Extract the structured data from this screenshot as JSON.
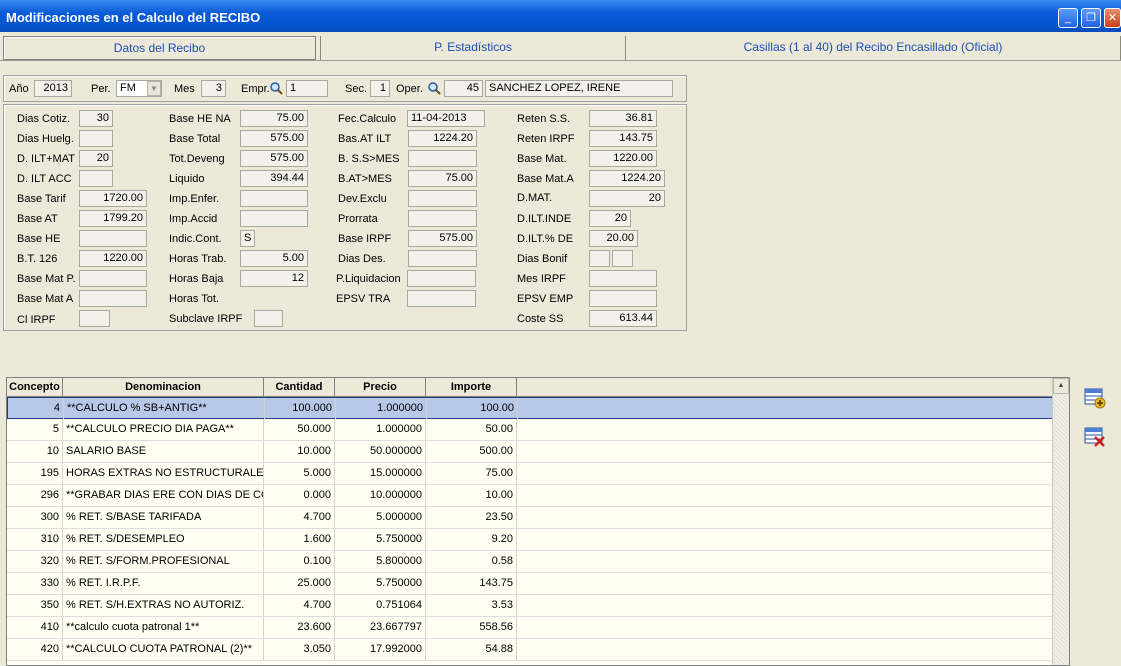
{
  "window": {
    "title": "Modificaciones en el Calculo del RECIBO"
  },
  "tabs": [
    {
      "label": "Datos del Recibo"
    },
    {
      "label": "P. Estadísticos"
    },
    {
      "label": "Casillas (1 al 40) del Recibo Encasillado (Oficial)"
    }
  ],
  "header": {
    "anio_label": "Año",
    "anio": "2013",
    "per_label": "Per.",
    "per": "FM",
    "mes_label": "Mes",
    "mes": "3",
    "empr_label": "Empr.",
    "empr": "1",
    "sec_label": "Sec.",
    "sec": "1",
    "oper_label": "Oper.",
    "oper": "45",
    "oper_name": "SANCHEZ LOPEZ, IRENE"
  },
  "col1": [
    {
      "label": "Dias Cotiz.",
      "value": "30"
    },
    {
      "label": "Dias Huelg.",
      "value": ""
    },
    {
      "label": "D. ILT+MAT",
      "value": "20"
    },
    {
      "label": "D. ILT ACC",
      "value": ""
    },
    {
      "label": "Base Tarif",
      "value": "1720.00"
    },
    {
      "label": "Base AT",
      "value": "1799.20"
    },
    {
      "label": "Base HE",
      "value": ""
    },
    {
      "label": "B.T. 126",
      "value": "1220.00"
    },
    {
      "label": "Base Mat P.",
      "value": ""
    },
    {
      "label": "Base Mat  A",
      "value": ""
    },
    {
      "label": "Cl IRPF",
      "value": ""
    }
  ],
  "col2": [
    {
      "label": "Base HE NA",
      "value": "75.00"
    },
    {
      "label": "Base Total",
      "value": "575.00"
    },
    {
      "label": "Tot.Deveng",
      "value": "575.00"
    },
    {
      "label": "Liquido",
      "value": "394.44"
    },
    {
      "label": "Imp.Enfer.",
      "value": ""
    },
    {
      "label": "Imp.Accid",
      "value": ""
    },
    {
      "label": "Indic.Cont.",
      "value": "S"
    },
    {
      "label": "Horas Trab.",
      "value": "5.00"
    },
    {
      "label": "Horas Baja",
      "value": "12"
    },
    {
      "label": "Horas Tot.",
      "value": ""
    },
    {
      "label": "Subclave IRPF",
      "value": ""
    }
  ],
  "col3": [
    {
      "label": "Fec.Calculo",
      "value": "11-04-2013"
    },
    {
      "label": "Bas.AT ILT",
      "value": "1224.20"
    },
    {
      "label": "B. S.S>MES",
      "value": ""
    },
    {
      "label": "B.AT>MES",
      "value": "75.00"
    },
    {
      "label": "Dev.Exclu",
      "value": ""
    },
    {
      "label": "Prorrata",
      "value": ""
    },
    {
      "label": "Base IRPF",
      "value": "575.00"
    },
    {
      "label": "Dias Des.",
      "value": ""
    },
    {
      "label": "P.Liquidacion",
      "value": ""
    },
    {
      "label": "EPSV TRA",
      "value": ""
    }
  ],
  "col4": [
    {
      "label": "Reten S.S.",
      "value": "36.81"
    },
    {
      "label": "Reten IRPF",
      "value": "143.75"
    },
    {
      "label": "Base Mat.",
      "value": "1220.00"
    },
    {
      "label": "Base Mat.A",
      "value": "1224.20"
    },
    {
      "label": "D.MAT.",
      "value": "20"
    },
    {
      "label": "D.ILT.INDE",
      "value": "20"
    },
    {
      "label": "D.ILT.% DE",
      "value": "20.00"
    },
    {
      "label": "Dias Bonif",
      "value": ""
    },
    {
      "label": "Mes IRPF",
      "value": ""
    },
    {
      "label": "EPSV EMP",
      "value": ""
    },
    {
      "label": "Coste SS",
      "value": "613.44"
    }
  ],
  "grid": {
    "columns": [
      "Concepto",
      "Denominacion",
      "Cantidad",
      "Precio",
      "Importe"
    ],
    "rows": [
      [
        "4",
        "**CALCULO % SB+ANTIG**",
        "100.000",
        "1.000000",
        "100.00"
      ],
      [
        "5",
        "**CALCULO PRECIO DIA PAGA**",
        "50.000",
        "1.000000",
        "50.00"
      ],
      [
        "10",
        "SALARIO BASE",
        "10.000",
        "50.000000",
        "500.00"
      ],
      [
        "195",
        "HORAS EXTRAS NO ESTRUCTURALES",
        "5.000",
        "15.000000",
        "75.00"
      ],
      [
        "296",
        "**GRABAR DIAS ERE CON DIAS DE COT*",
        "0.000",
        "10.000000",
        "10.00"
      ],
      [
        "300",
        "% RET. S/BASE TARIFADA",
        "4.700",
        "5.000000",
        "23.50"
      ],
      [
        "310",
        "% RET. S/DESEMPLEO",
        "1.600",
        "5.750000",
        "9.20"
      ],
      [
        "320",
        "% RET. S/FORM.PROFESIONAL",
        "0.100",
        "5.800000",
        "0.58"
      ],
      [
        "330",
        "% RET. I.R.P.F.",
        "25.000",
        "5.750000",
        "143.75"
      ],
      [
        "350",
        "% RET. S/H.EXTRAS NO AUTORIZ.",
        "4.700",
        "0.751064",
        "3.53"
      ],
      [
        "410",
        "**calculo cuota patronal 1**",
        "23.600",
        "23.667797",
        "558.56"
      ],
      [
        "420",
        "**CALCULO CUOTA PATRONAL (2)**",
        "3.050",
        "17.992000",
        "54.88"
      ]
    ]
  }
}
